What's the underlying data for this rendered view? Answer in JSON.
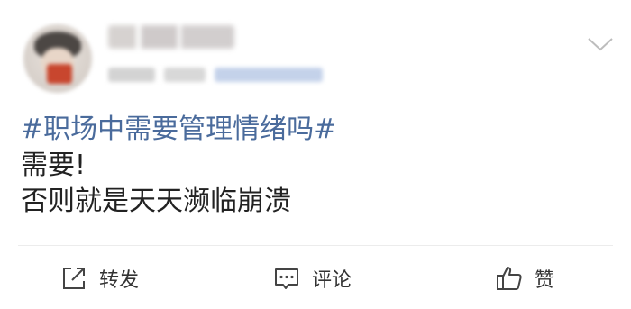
{
  "post": {
    "hashtag": "#职场中需要管理情绪吗#",
    "lines": [
      "需要!",
      "否则就是天天濒临崩溃"
    ]
  },
  "actions": {
    "repost_label": "转发",
    "comment_label": "评论",
    "like_label": "赞"
  },
  "colors": {
    "hashtag": "#4a6b9c",
    "text": "#222222",
    "icon": "#444444"
  },
  "icons": {
    "more": "chevron-down-icon",
    "repost": "share-external-icon",
    "comment": "comment-icon",
    "like": "thumbs-up-icon"
  }
}
